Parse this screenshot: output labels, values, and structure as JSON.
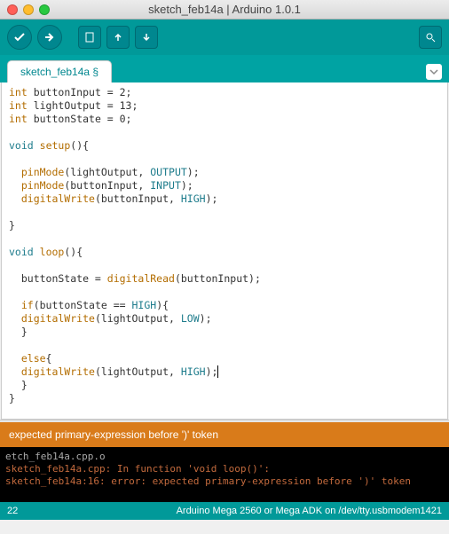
{
  "window": {
    "title": "sketch_feb14a | Arduino 1.0.1"
  },
  "tab": {
    "label": "sketch_feb14a §"
  },
  "code": {
    "l1_a": "int",
    "l1_b": " buttonInput = 2;",
    "l2_a": "int",
    "l2_b": " lightOutput = 13;",
    "l3_a": "int",
    "l3_b": " buttonState = 0;",
    "l5_a": "void",
    "l5_b": " ",
    "l5_c": "setup",
    "l5_d": "(){",
    "l7_a": "  pinMode",
    "l7_b": "(lightOutput, ",
    "l7_c": "OUTPUT",
    "l7_d": ");",
    "l8_a": "  pinMode",
    "l8_b": "(buttonInput, ",
    "l8_c": "INPUT",
    "l8_d": ");",
    "l9_a": "  digitalWrite",
    "l9_b": "(buttonInput, ",
    "l9_c": "HIGH",
    "l9_d": ");",
    "l11": "}",
    "l13_a": "void",
    "l13_b": " ",
    "l13_c": "loop",
    "l13_d": "(){",
    "l15_a": "  buttonState = ",
    "l15_b": "digitalRead",
    "l15_c": "(buttonInput);",
    "l17_a": "  if",
    "l17_b": "(buttonState == ",
    "l17_c": "HIGH",
    "l17_d": "){",
    "l18_a": "  digitalWrite",
    "l18_b": "(lightOutput, ",
    "l18_c": "LOW",
    "l18_d": ");",
    "l19": "  }",
    "l21_a": "  else",
    "l21_b": "{",
    "l22_a": "  digitalWrite",
    "l22_b": "(lightOutput, ",
    "l22_c": "HIGH",
    "l22_d": ");",
    "l23": "  }",
    "l24": "}"
  },
  "error": {
    "message": "expected primary-expression before ')' token"
  },
  "console": {
    "l1": "etch_feb14a.cpp.o",
    "l2": "sketch_feb14a.cpp: In function 'void loop()':",
    "l3": "sketch_feb14a:16: error: expected primary-expression before ')' token"
  },
  "status": {
    "line": "22",
    "board": "Arduino Mega 2560 or Mega ADK on /dev/tty.usbmodem1421"
  }
}
